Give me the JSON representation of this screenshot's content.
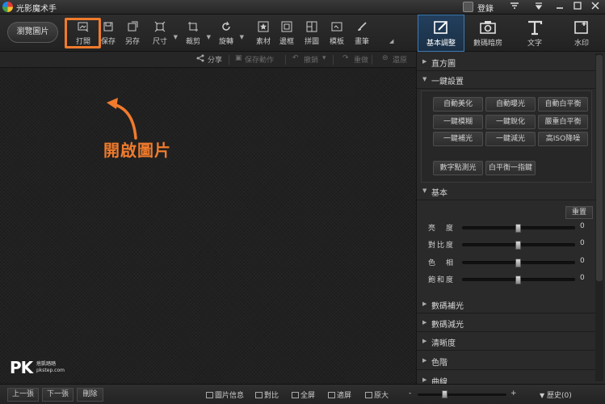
{
  "app": {
    "title": "光影魔术手",
    "login": "登錄"
  },
  "toolbar": {
    "browse": "瀏覽圖片",
    "tools": [
      {
        "label": "打開",
        "icon": "open-image-icon"
      },
      {
        "label": "保存",
        "icon": "save-icon"
      },
      {
        "label": "另存",
        "icon": "save-as-icon"
      },
      {
        "label": "尺寸",
        "icon": "resize-icon"
      },
      {
        "label": "裁剪",
        "icon": "crop-icon"
      },
      {
        "label": "旋轉",
        "icon": "rotate-icon"
      },
      {
        "label": "素材",
        "icon": "star-icon"
      },
      {
        "label": "邊框",
        "icon": "frame-icon"
      },
      {
        "label": "拼圖",
        "icon": "collage-icon"
      },
      {
        "label": "模板",
        "icon": "template-icon"
      },
      {
        "label": "畫筆",
        "icon": "brush-icon"
      }
    ]
  },
  "right_tabs": [
    {
      "label": "基本調整",
      "icon": "basic-adjust-icon"
    },
    {
      "label": "數碼暗房",
      "icon": "camera-icon"
    },
    {
      "label": "文字",
      "icon": "text-icon"
    },
    {
      "label": "水印",
      "icon": "watermark-icon"
    }
  ],
  "secondary": {
    "share": "分享",
    "save_action": "保存動作",
    "undo": "撤銷",
    "redo": "重做",
    "restore": "還原"
  },
  "annotation": {
    "text": "開啟圖片"
  },
  "logo": {
    "big": "PK",
    "small1": "痞凱踏踏",
    "small2": "pkstep.com"
  },
  "panel": {
    "histogram": "直方圖",
    "onekey": "一鍵設置",
    "onekey_buttons": [
      [
        "自動美化",
        "自動曝光",
        "自動白平衡"
      ],
      [
        "一鍵模糊",
        "一鍵銳化",
        "嚴重白平衡"
      ],
      [
        "一鍵補光",
        "一鍵減光",
        "高ISO降噪"
      ]
    ],
    "extra_buttons": [
      "數字點測光",
      "白平衡一指鍵"
    ],
    "basic": "基本",
    "reset": "重置",
    "sliders": [
      {
        "label": "亮　度",
        "value": "0"
      },
      {
        "label": "對比度",
        "value": "0"
      },
      {
        "label": "色　相",
        "value": "0"
      },
      {
        "label": "飽和度",
        "value": "0"
      }
    ],
    "sections": [
      "數碼補光",
      "數碼減光",
      "清晰度",
      "色階",
      "曲線"
    ]
  },
  "bottom": {
    "prev": "上一張",
    "next": "下一張",
    "delete": "刪除",
    "info": "圖片信息",
    "compare": "對比",
    "fullscreen": "全屏",
    "fit": "適屏",
    "original": "原大",
    "zoom_minus": "-",
    "zoom_plus": "+",
    "history": "歷史(0)"
  }
}
